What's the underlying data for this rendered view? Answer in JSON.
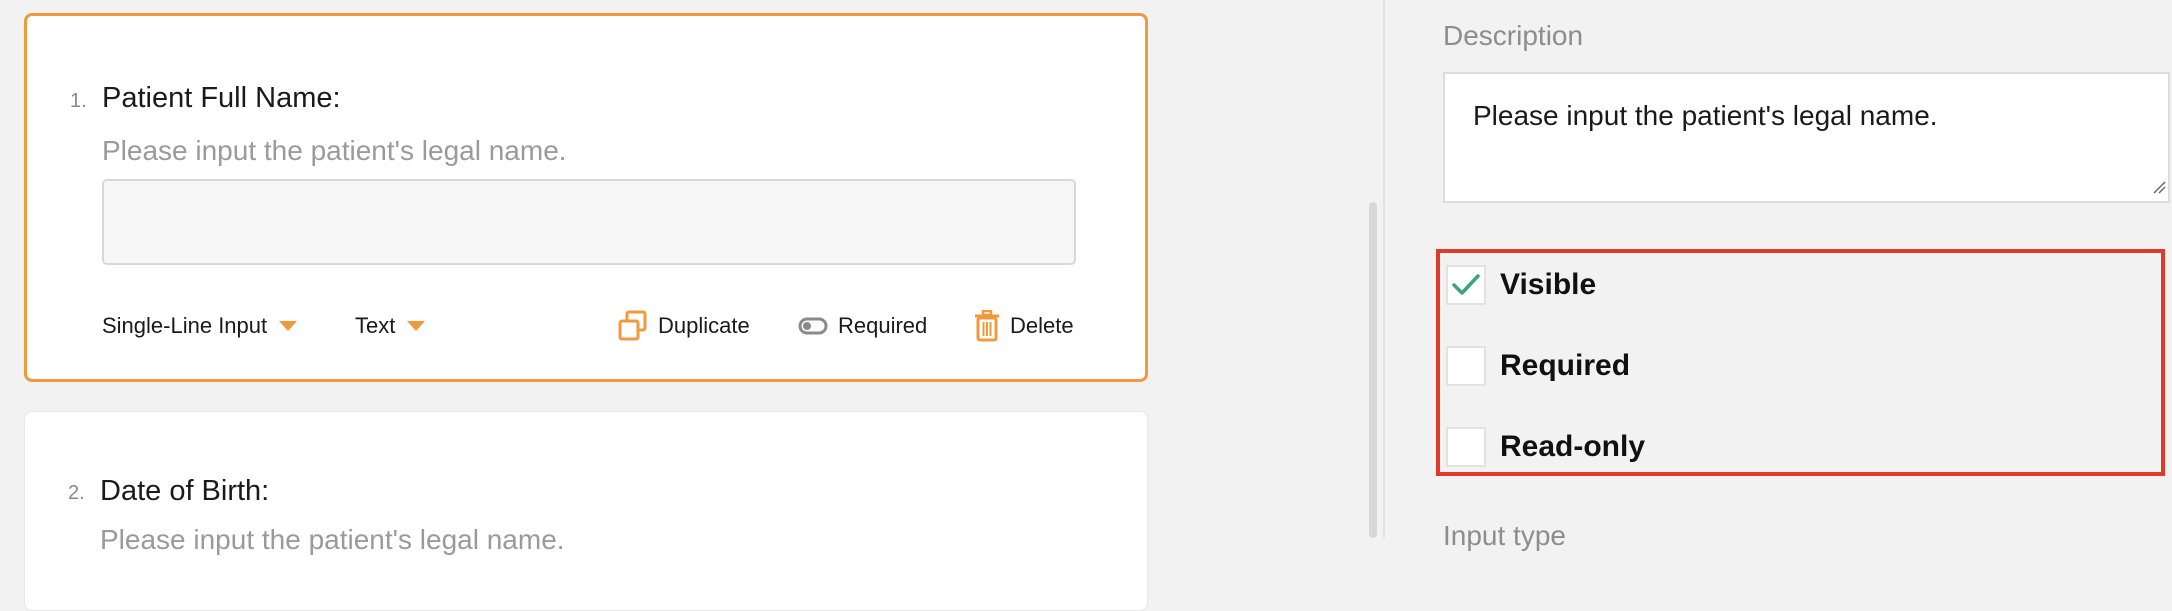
{
  "questions": [
    {
      "number": "1.",
      "title": "Patient Full Name:",
      "description": "Please input the patient's legal name.",
      "input_value": ""
    },
    {
      "number": "2.",
      "title": "Date of Birth:",
      "description": "Please input the patient's legal name."
    }
  ],
  "toolbar": {
    "type_label": "Single-Line Input",
    "format_label": "Text",
    "duplicate_label": "Duplicate",
    "required_label": "Required",
    "delete_label": "Delete",
    "icons": {
      "duplicate": "duplicate-icon",
      "required": "toggle-icon",
      "delete": "trash-icon",
      "dropdown": "caret-down-icon"
    }
  },
  "properties": {
    "description_label": "Description",
    "description_value": "Please input the patient's legal name.",
    "options": [
      {
        "label": "Visible",
        "checked": true
      },
      {
        "label": "Required",
        "checked": false
      },
      {
        "label": "Read-only",
        "checked": false
      }
    ],
    "input_type_label": "Input type"
  },
  "colors": {
    "accent": "#ef9a3c",
    "highlight": "#e03a2c",
    "check": "#3aa57a"
  }
}
